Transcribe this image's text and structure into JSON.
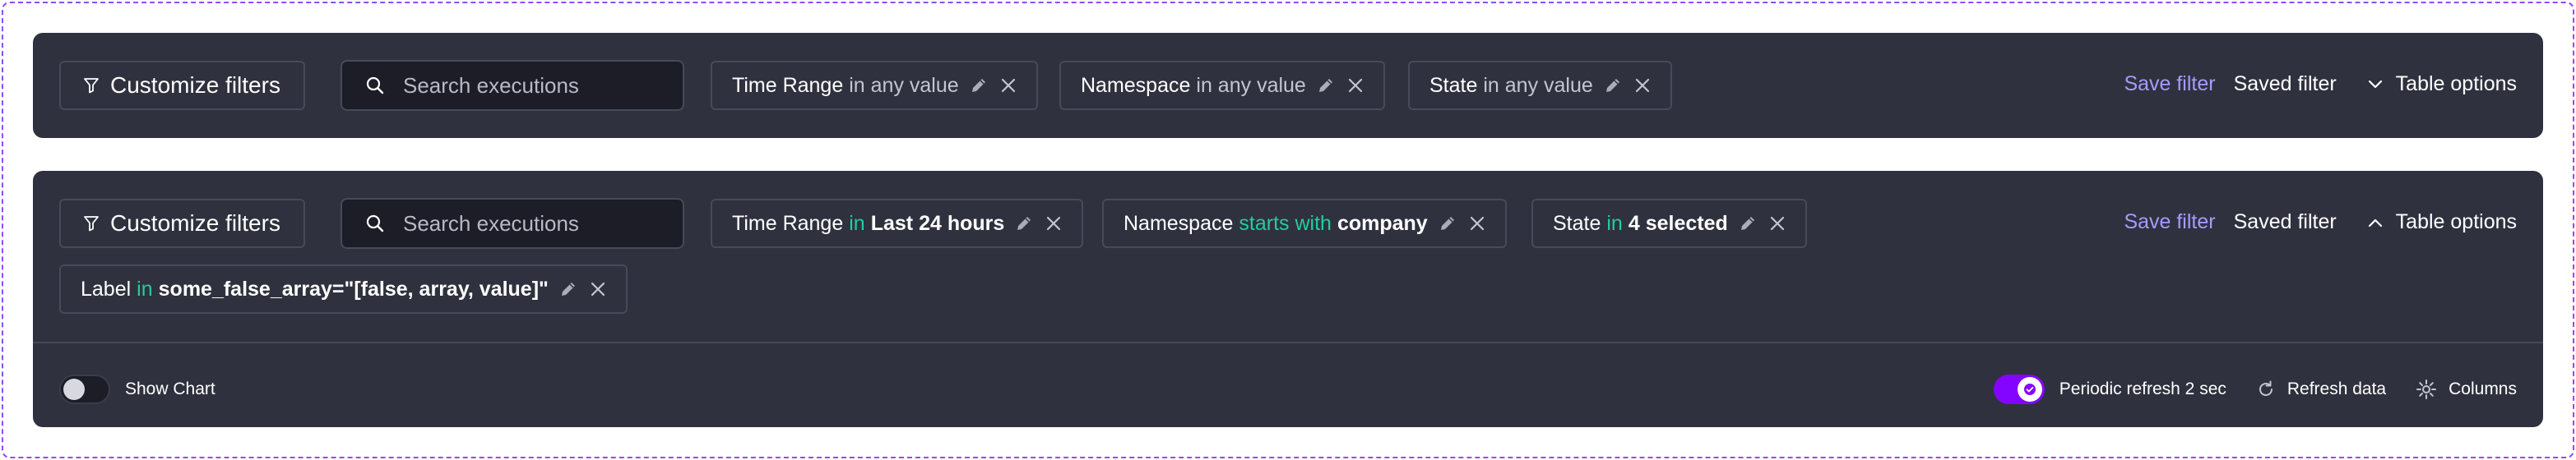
{
  "colors": {
    "panel_bg": "#2f313e",
    "border": "#474a59",
    "accent_link": "#a69bff",
    "operator_green": "#21ce9c",
    "toggle_on": "#8405ff",
    "frame_dashed": "#9747ff"
  },
  "panel1": {
    "customize_label": "Customize filters",
    "search_placeholder": "Search executions",
    "chips": [
      {
        "field": "Time Range",
        "operator": "in any value"
      },
      {
        "field": "Namespace",
        "operator": "in any value"
      },
      {
        "field": "State",
        "operator": "in any value"
      }
    ],
    "save_filter": "Save filter",
    "saved_filter": "Saved filter",
    "table_options": "Table options",
    "table_options_icon": "chevron-down-icon"
  },
  "panel2": {
    "customize_label": "Customize filters",
    "search_placeholder": "Search executions",
    "chips": [
      {
        "field": "Time Range",
        "operator": "in",
        "value": "Last 24 hours"
      },
      {
        "field": "Namespace",
        "operator": "starts with",
        "value": "company"
      },
      {
        "field": "State",
        "operator": "in",
        "value": "4 selected"
      },
      {
        "field": "Label",
        "operator": "in",
        "value": "some_false_array=\"[false, array, value]\""
      }
    ],
    "save_filter": "Save filter",
    "saved_filter": "Saved filter",
    "table_options": "Table options",
    "table_options_icon": "chevron-up-icon",
    "show_chart_label": "Show Chart",
    "show_chart_on": false,
    "periodic_refresh_label": "Periodic refresh 2 sec",
    "periodic_refresh_on": true,
    "refresh_data_label": "Refresh data",
    "columns_label": "Columns"
  }
}
